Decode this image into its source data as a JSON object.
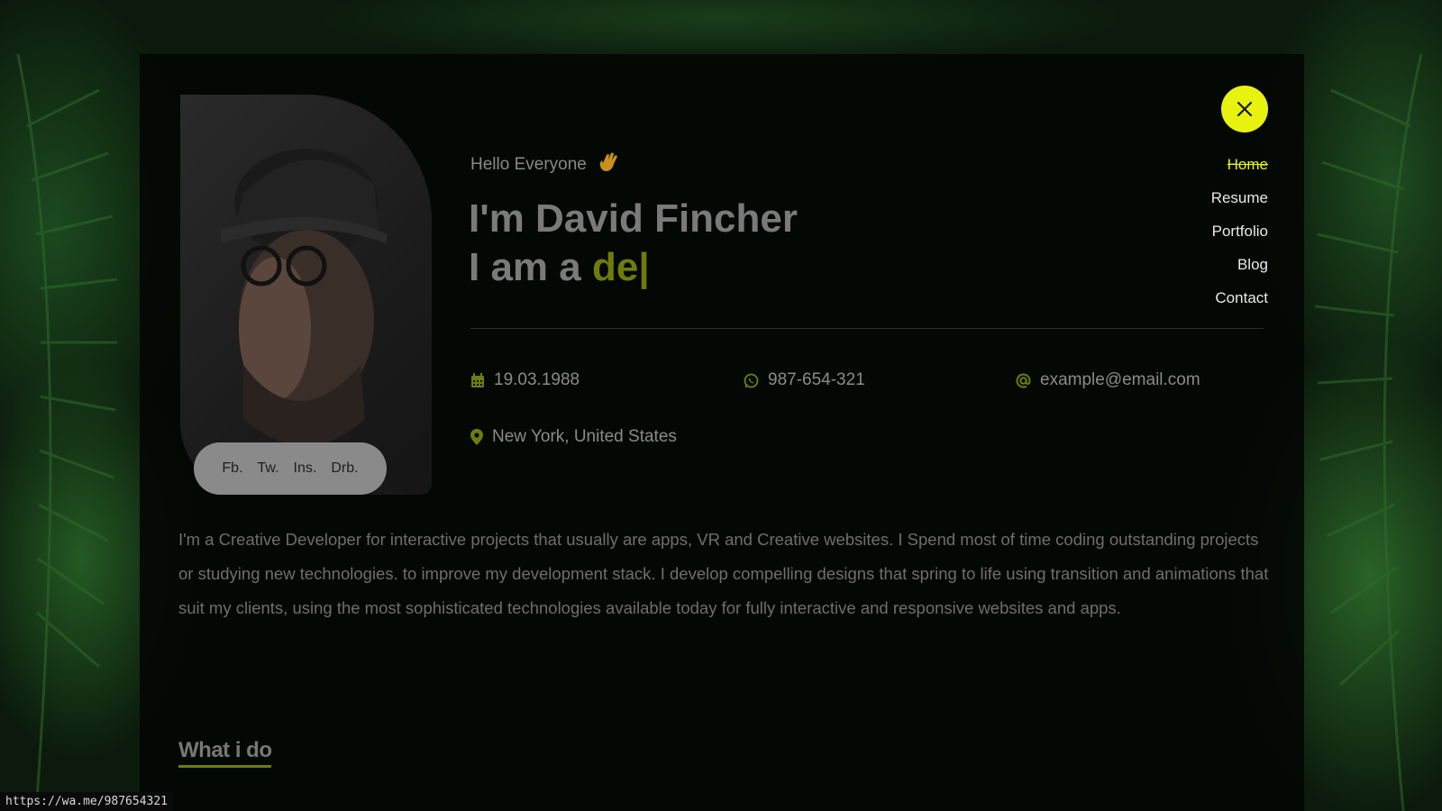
{
  "colors": {
    "accent": "#e7f30e",
    "accent_dim": "#6f7c0b",
    "panel": "#040804",
    "text_muted": "#8a8a8a"
  },
  "profile": {
    "greeting": "Hello Everyone",
    "greeting_icon": "waving-hand-icon",
    "name": "I'm David Fincher",
    "role_prefix": "I am a",
    "role_typed": "de|"
  },
  "social": [
    "Fb.",
    "Tw.",
    "Ins.",
    "Drb."
  ],
  "info": {
    "birthday": {
      "icon": "calendar-icon",
      "value": "19.03.1988"
    },
    "phone": {
      "icon": "whatsapp-icon",
      "value": "987-654-321"
    },
    "email": {
      "icon": "at-icon",
      "value": "example@email.com"
    },
    "location": {
      "icon": "map-pin-icon",
      "value": "New York, United States"
    }
  },
  "about": "I'm a Creative Developer for interactive projects that usually are apps, VR and Creative websites. I Spend most of time coding outstanding projects or studying new technologies. to improve my development stack. I develop compelling designs that spring to life using transition and animations that suit my clients, using the most sophisticated technologies available today for fully interactive and responsive websites and apps.",
  "section_title": "What i do",
  "nav": {
    "items": [
      "Home",
      "Resume",
      "Portfolio",
      "Blog",
      "Contact"
    ],
    "active": "Home",
    "close_icon": "close-icon"
  },
  "status_url": "https://wa.me/987654321"
}
